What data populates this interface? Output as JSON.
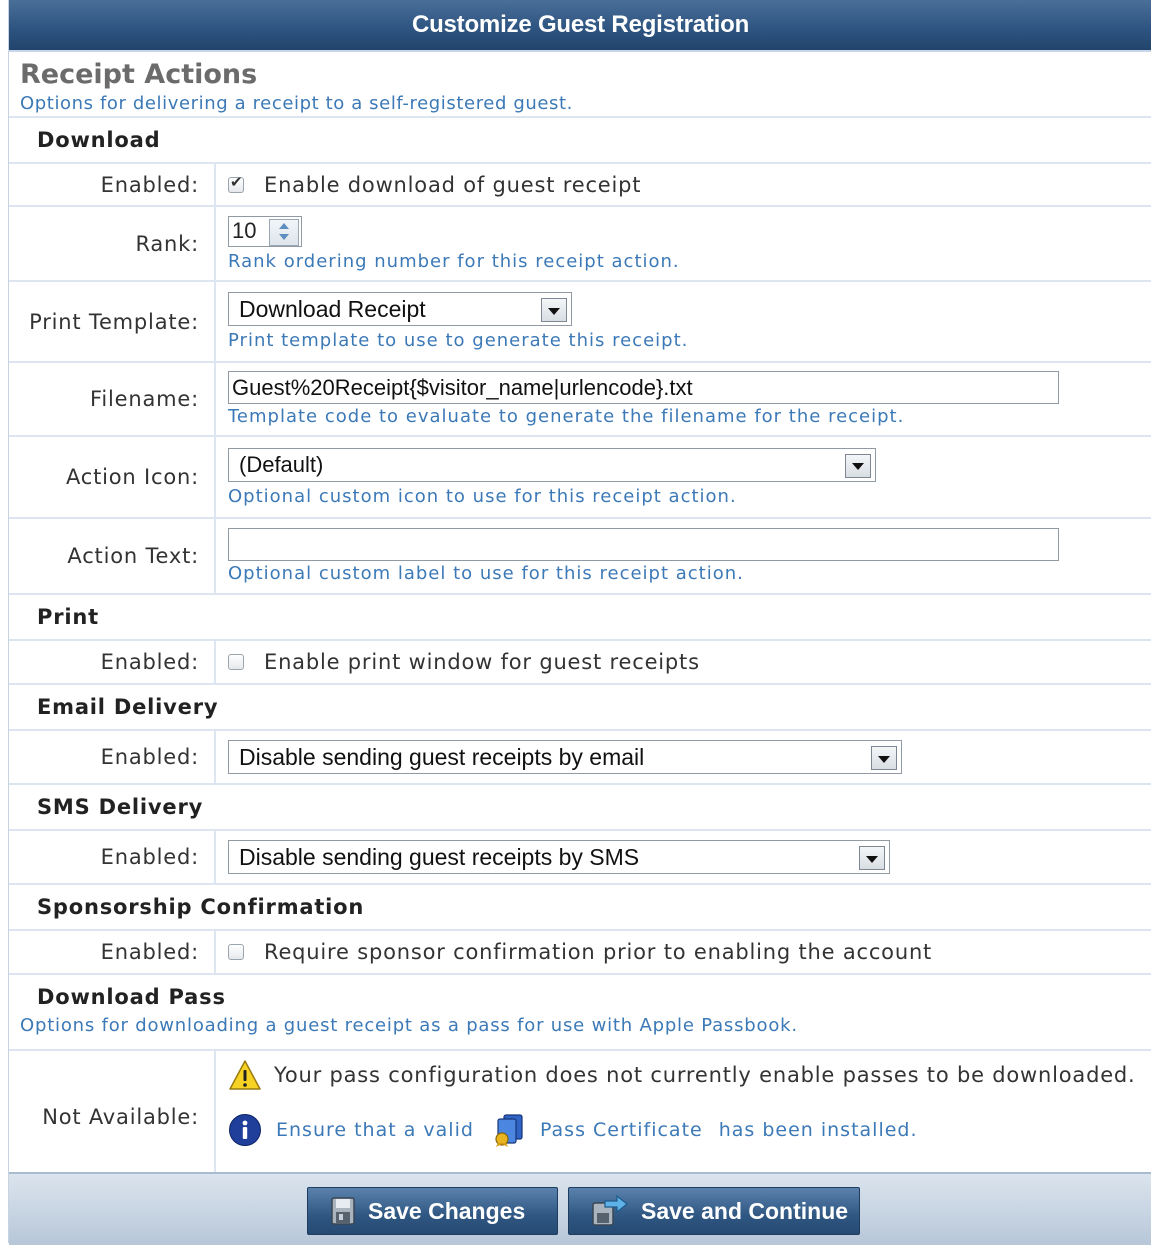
{
  "window": {
    "title": "Customize Guest Registration"
  },
  "section": {
    "title": "Receipt Actions",
    "description": "Options for delivering a receipt to a self-registered guest."
  },
  "download": {
    "heading": "Download",
    "enabled_label": "Enabled:",
    "enabled_text": "Enable download of guest receipt",
    "enabled_checked": true,
    "rank_label": "Rank:",
    "rank_value": "10",
    "rank_hint": "Rank ordering number for this receipt action.",
    "template_label": "Print Template:",
    "template_value": "Download Receipt",
    "template_hint": "Print template to use to generate this receipt.",
    "filename_label": "Filename:",
    "filename_value": "Guest%20Receipt{$visitor_name|urlencode}.txt",
    "filename_hint": "Template code to evaluate to generate the filename for the receipt.",
    "icon_label": "Action Icon:",
    "icon_value": "(Default)",
    "icon_hint": "Optional custom icon to use for this receipt action.",
    "text_label": "Action Text:",
    "text_value": "",
    "text_hint": "Optional custom label to use for this receipt action."
  },
  "print": {
    "heading": "Print",
    "enabled_label": "Enabled:",
    "enabled_text": "Enable print window for guest receipts",
    "enabled_checked": false
  },
  "email": {
    "heading": "Email Delivery",
    "enabled_label": "Enabled:",
    "value": "Disable sending guest receipts by email"
  },
  "sms": {
    "heading": "SMS Delivery",
    "enabled_label": "Enabled:",
    "value": "Disable sending guest receipts by SMS"
  },
  "sponsorship": {
    "heading": "Sponsorship Confirmation",
    "enabled_label": "Enabled:",
    "enabled_text": "Require sponsor confirmation prior to enabling the account",
    "enabled_checked": false
  },
  "pass": {
    "heading": "Download Pass",
    "description": "Options for downloading a guest receipt as a pass for use with Apple Passbook.",
    "label": "Not Available:",
    "warning": "Your pass configuration does not currently enable passes to be downloaded.",
    "info_prefix": "Ensure that a valid",
    "info_link": "Pass Certificate",
    "info_suffix": "has been installed."
  },
  "footer": {
    "save_label": "Save Changes",
    "save_continue_label": "Save and Continue"
  },
  "colors": {
    "accent": "#2f5582",
    "hint": "#3c79b7"
  },
  "icons": [
    "warning-icon",
    "info-icon",
    "certificate-icon",
    "save-icon",
    "save-continue-icon"
  ]
}
